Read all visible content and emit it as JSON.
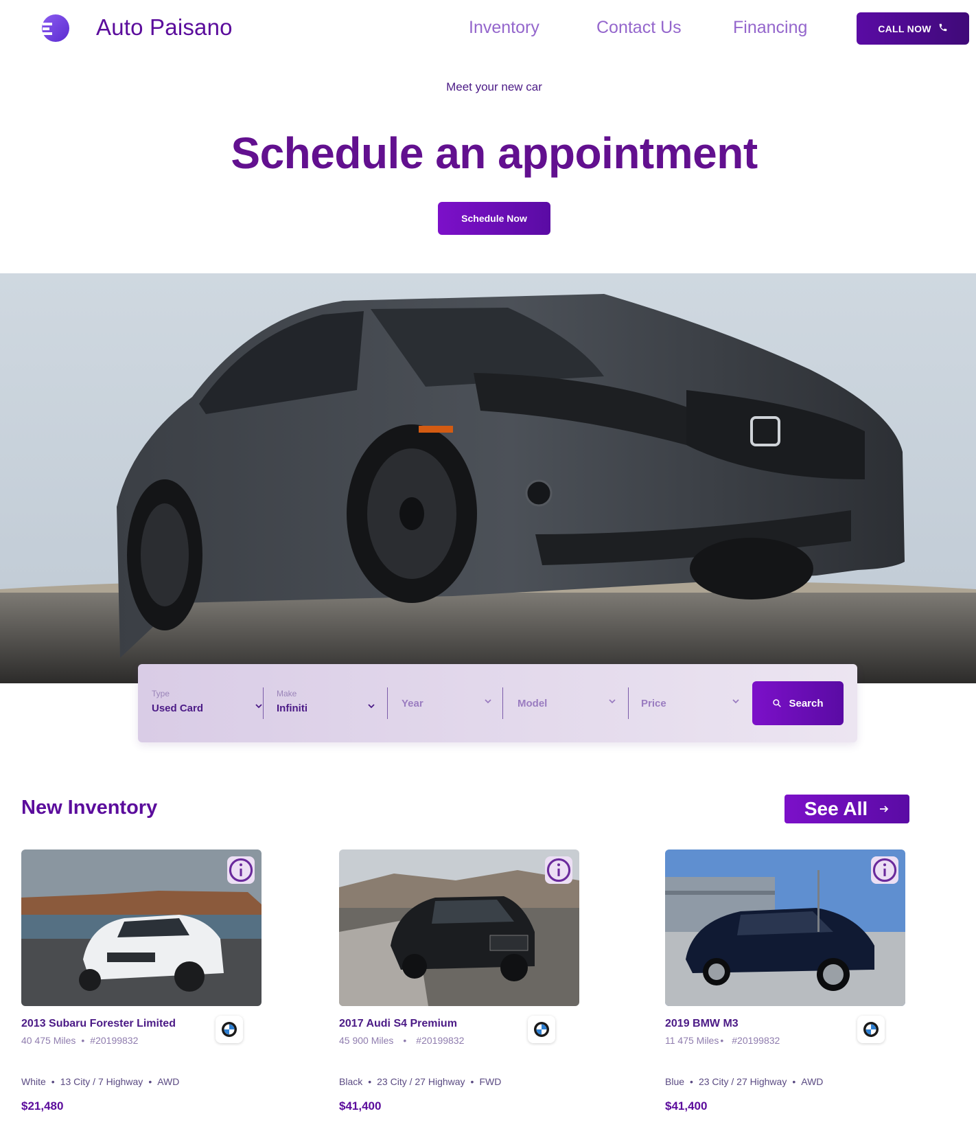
{
  "header": {
    "brand": "Auto Paisano",
    "nav": [
      "Inventory",
      "Contact Us",
      "Financing"
    ],
    "call_label": "CALL NOW",
    "logo_icon": "auto-paisano-logo",
    "call_icon": "phone-icon"
  },
  "hero": {
    "eyebrow": "Meet your new car",
    "title": "Schedule an appointment",
    "cta": "Schedule Now"
  },
  "search": {
    "fields": [
      {
        "label": "Type",
        "value": "Used Card"
      },
      {
        "label": "Make",
        "value": "Infiniti"
      },
      {
        "label": "",
        "value": "Year"
      },
      {
        "label": "",
        "value": "Model"
      },
      {
        "label": "",
        "value": "Price"
      }
    ],
    "button": "Search",
    "button_icon": "search-icon"
  },
  "inventory": {
    "title": "New Inventory",
    "see_all": "See All",
    "cards": [
      {
        "name": "2013 Subaru Forester Limited",
        "miles": "40 475 Miles",
        "stock": "#20199832",
        "color": "White",
        "mpg": "13 City / 7 Highway",
        "drive": "AWD",
        "price": "$21,480"
      },
      {
        "name": "2017 Audi S4 Premium",
        "miles": "45 900 Miles",
        "stock": "#20199832",
        "color": "Black",
        "mpg": "23 City / 27 Highway",
        "drive": "FWD",
        "price": "$41,400"
      },
      {
        "name": "2019 BMW M3",
        "miles": "11 475 Miles",
        "stock": "#20199832",
        "color": "Blue",
        "mpg": "23 City / 27 Highway",
        "drive": "AWD",
        "price": "$41,400"
      }
    ]
  },
  "colors": {
    "brand_purple": "#5b0c9c",
    "nav_purple": "#9466cc",
    "button_gradient_start": "#7c10c9",
    "button_gradient_end": "#5a0ba4"
  }
}
